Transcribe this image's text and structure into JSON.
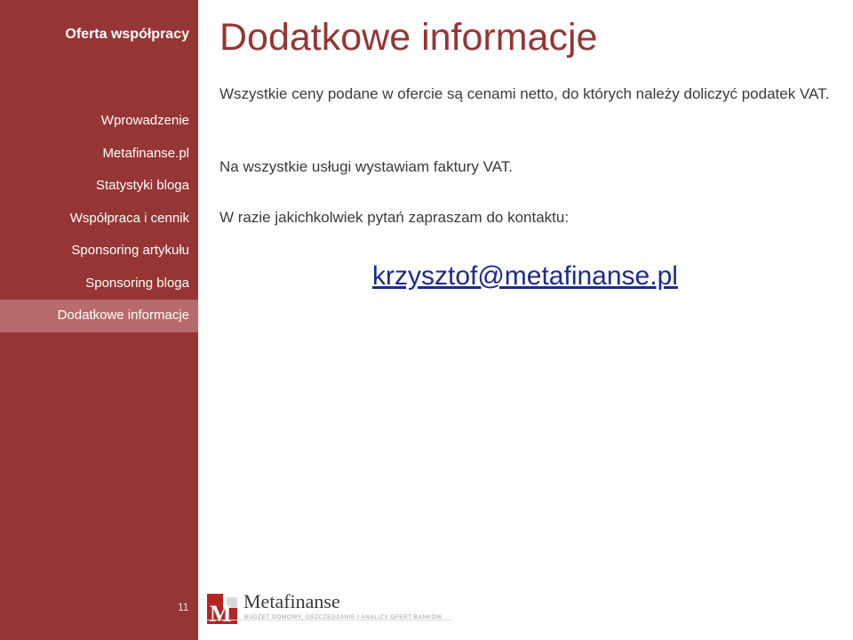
{
  "sidebar": {
    "title": "Oferta współpracy",
    "items": [
      {
        "label": "Wprowadzenie"
      },
      {
        "label": "Metafinanse.pl"
      },
      {
        "label": "Statystyki bloga"
      },
      {
        "label": "Współpraca i cennik"
      },
      {
        "label": "Sponsoring artykułu"
      },
      {
        "label": "Sponsoring bloga"
      },
      {
        "label": "Dodatkowe informacje"
      }
    ],
    "page_number": "11"
  },
  "main": {
    "title": "Dodatkowe informacje",
    "paragraphs": [
      "Wszystkie ceny podane w ofercie są cenami netto, do których należy doliczyć podatek VAT.",
      "Na wszystkie usługi wystawiam faktury VAT.",
      "W razie jakichkolwiek pytań zapraszam do kontaktu:"
    ],
    "email": "krzysztof@metafinanse.pl"
  },
  "footer": {
    "logo_name": "Metafinanse",
    "logo_tagline": "BUDŻET DOMOWY, OSZCZĘDZANIE I ANALIZY OFERT BANKÓW"
  },
  "colors": {
    "sidebar": "#963535",
    "active_item": "#b86b6b",
    "title": "#963535",
    "link": "#1e2a8c"
  }
}
